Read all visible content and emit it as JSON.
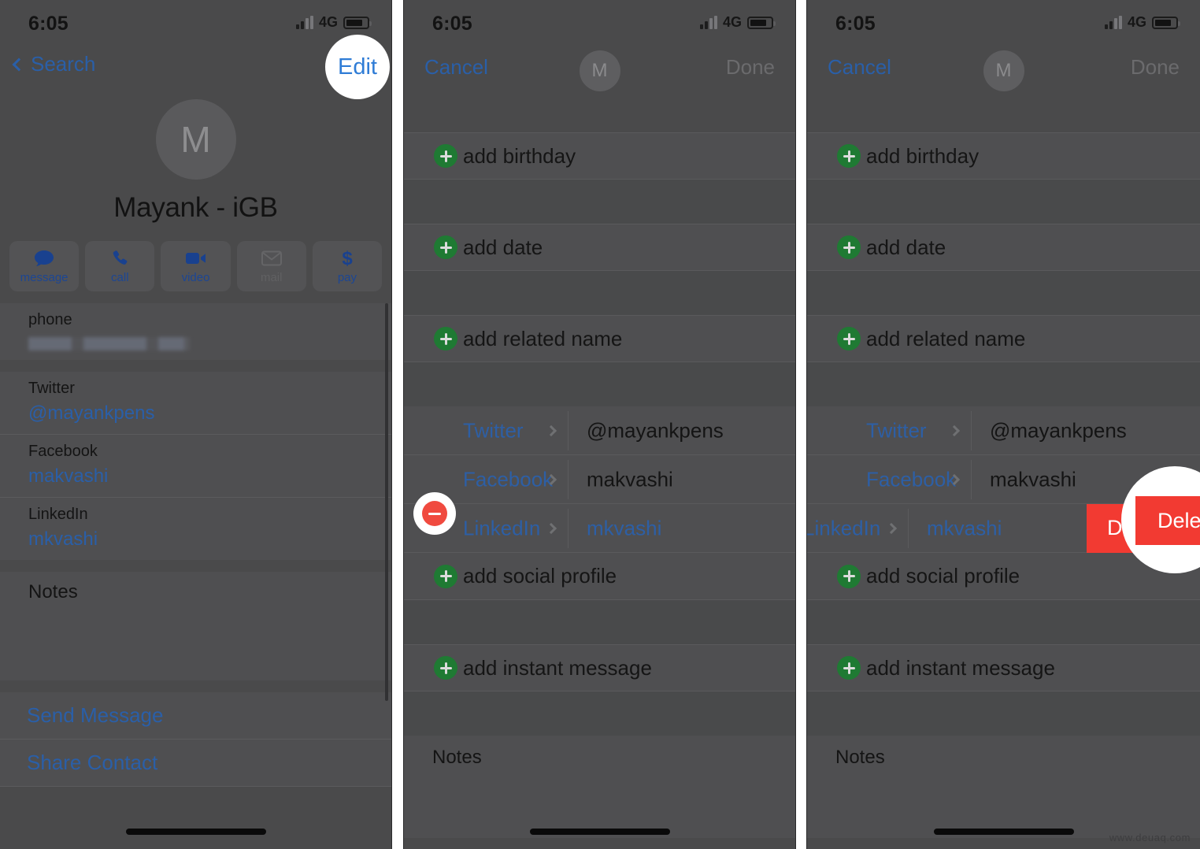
{
  "status_bar": {
    "time": "6:05",
    "network": "4G",
    "signal_icon": "cellular-bars-icon",
    "battery_icon": "battery-icon"
  },
  "panel1": {
    "nav": {
      "back_label": "Search",
      "back_icon": "chevron-left-icon",
      "edit_label": "Edit"
    },
    "avatar_initial": "M",
    "contact_name": "Mayank - iGB",
    "actions": [
      {
        "label": "message",
        "icon": "message-bubble-icon",
        "enabled": true
      },
      {
        "label": "call",
        "icon": "phone-handset-icon",
        "enabled": true
      },
      {
        "label": "video",
        "icon": "video-camera-icon",
        "enabled": true
      },
      {
        "label": "mail",
        "icon": "envelope-icon",
        "enabled": false
      },
      {
        "label": "pay",
        "icon": "dollar-sign-icon",
        "enabled": true
      }
    ],
    "phone": {
      "label": "phone",
      "value_redacted": true
    },
    "fields": [
      {
        "label": "Twitter",
        "value": "@mayankpens"
      },
      {
        "label": "Facebook",
        "value": "makvashi"
      },
      {
        "label": "LinkedIn",
        "value": "mkvashi"
      }
    ],
    "notes_label": "Notes",
    "links": [
      "Send Message",
      "Share Contact"
    ]
  },
  "panel2": {
    "nav": {
      "cancel_label": "Cancel",
      "done_label": "Done",
      "avatar_initial": "M"
    },
    "add_rows_top": [
      "add birthday",
      "add date",
      "add related name"
    ],
    "social_rows": [
      {
        "label": "Twitter",
        "value": "@mayankpens",
        "value_is_link": false
      },
      {
        "label": "Facebook",
        "value": "makvashi",
        "value_is_link": false
      },
      {
        "label": "LinkedIn",
        "value": "mkvashi",
        "value_is_link": true
      }
    ],
    "add_social_label": "add social profile",
    "add_instant_label": "add instant message",
    "notes_label": "Notes",
    "highlight_minus": {
      "icon": "minus-circle-icon",
      "target_row": "LinkedIn"
    }
  },
  "panel3": {
    "nav": {
      "cancel_label": "Cancel",
      "done_label": "Done",
      "avatar_initial": "M"
    },
    "add_rows_top": [
      "add birthday",
      "add date",
      "add related name"
    ],
    "social_rows": [
      {
        "label": "Twitter",
        "value": "@mayankpens",
        "value_is_link": false
      },
      {
        "label": "Facebook",
        "value": "makvashi",
        "value_is_link": false
      },
      {
        "label": "LinkedIn",
        "value": "mkvashi",
        "value_is_link": true
      }
    ],
    "add_social_label": "add social profile",
    "add_instant_label": "add instant message",
    "notes_label": "Notes",
    "delete_label": "Delete"
  },
  "watermark": "www.deuaq.com",
  "colors": {
    "accent_blue": "#2a5fa8",
    "delete_red": "#f23a32",
    "add_green": "#1f7a33",
    "remove_red": "#9a2420",
    "panel_bg": "#4a4a4b",
    "card_bg": "#4f4f51"
  }
}
